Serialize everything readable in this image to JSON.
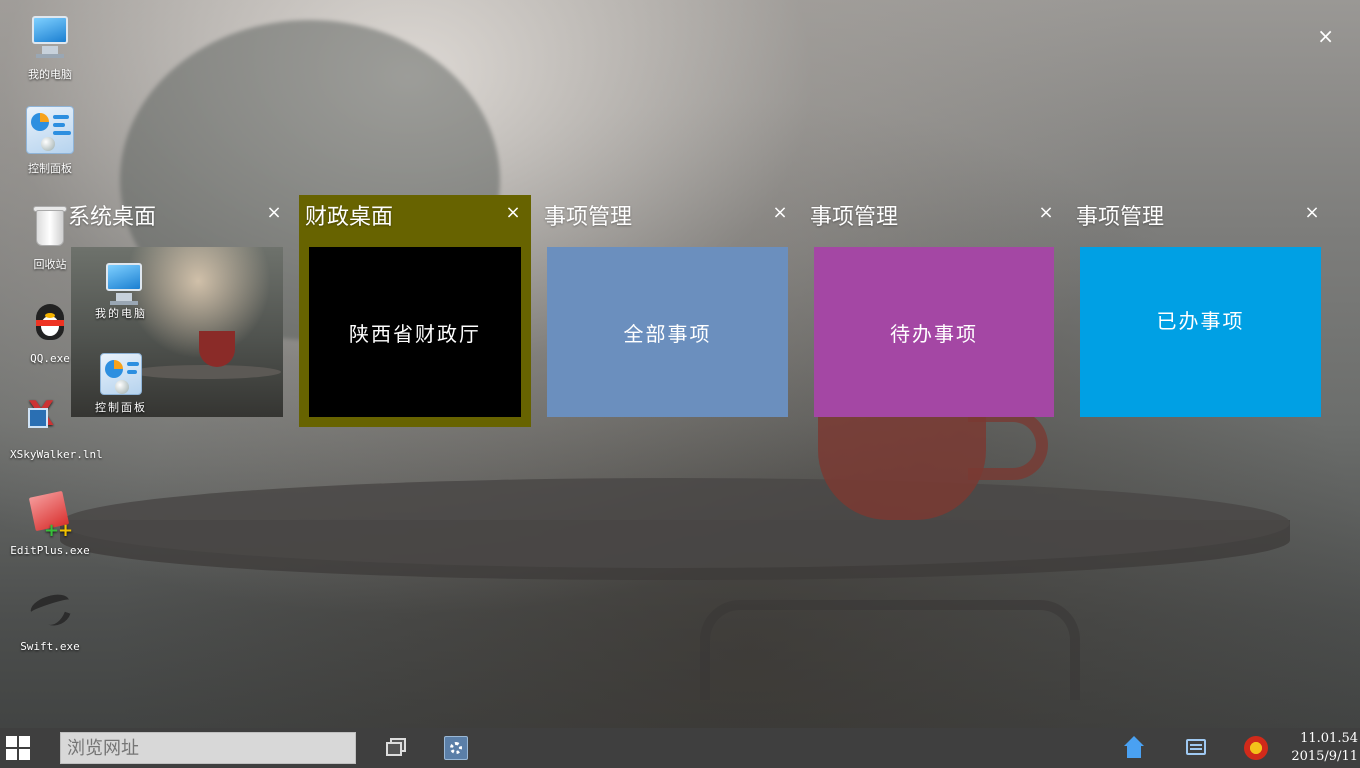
{
  "desktop": {
    "icons": [
      {
        "label": "我的电脑"
      },
      {
        "label": "控制面板"
      },
      {
        "label": "回收站"
      },
      {
        "label": "QQ.exe"
      },
      {
        "label": "XSkyWalker.lnl"
      },
      {
        "label": "EditPlus.exe"
      },
      {
        "label": "Swift.exe"
      }
    ],
    "close_symbol": "×"
  },
  "tile_groups": [
    {
      "title": "系统桌面",
      "close": "×",
      "preview_icons": [
        {
          "label": "我的电脑"
        },
        {
          "label": "控制面板"
        }
      ]
    },
    {
      "title": "财政桌面",
      "close": "×",
      "tile_label": "陕西省财政厅",
      "color": "#000000",
      "group_color": "#676300"
    },
    {
      "title": "事项管理",
      "close": "×",
      "tile_label": "全部事项",
      "color": "#6b8fbe"
    },
    {
      "title": "事项管理",
      "close": "×",
      "tile_label": "待办事项",
      "color": "#a447a4"
    },
    {
      "title": "事项管理",
      "close": "×",
      "tile_label": "已办事项",
      "color": "#00a0e4"
    }
  ],
  "taskbar": {
    "url_placeholder": "浏览网址",
    "icons": [
      "windows-start-icon",
      "task-view-icon",
      "settings-icon",
      "home-icon",
      "message-icon",
      "national-emblem-icon"
    ],
    "clock_time": "11.01.54",
    "clock_date": "2015/9/11"
  }
}
